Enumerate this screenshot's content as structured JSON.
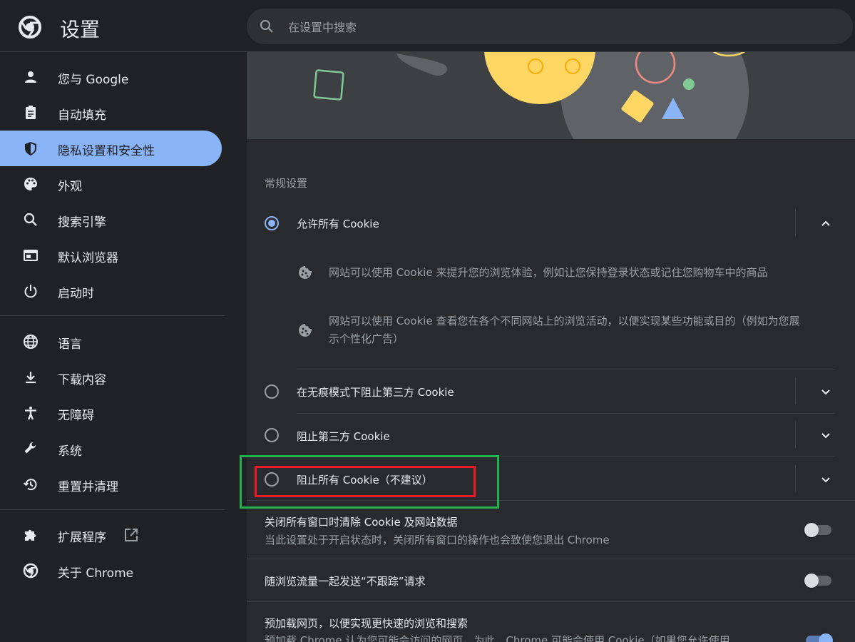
{
  "header": {
    "title": "设置",
    "search_placeholder": "在设置中搜索"
  },
  "sidebar": {
    "items": [
      {
        "label": "您与 Google",
        "icon": "person-icon"
      },
      {
        "label": "自动填充",
        "icon": "clipboard-icon"
      },
      {
        "label": "隐私设置和安全性",
        "icon": "shield-icon",
        "active": true
      },
      {
        "label": "外观",
        "icon": "palette-icon"
      },
      {
        "label": "搜索引擎",
        "icon": "search-icon"
      },
      {
        "label": "默认浏览器",
        "icon": "browser-icon"
      },
      {
        "label": "启动时",
        "icon": "power-icon"
      },
      {
        "label": "语言",
        "icon": "globe-icon"
      },
      {
        "label": "下载内容",
        "icon": "download-icon"
      },
      {
        "label": "无障碍",
        "icon": "accessibility-icon"
      },
      {
        "label": "系统",
        "icon": "wrench-icon"
      },
      {
        "label": "重置并清理",
        "icon": "history-icon"
      },
      {
        "label": "扩展程序",
        "icon": "puzzle-icon"
      },
      {
        "label": "关于 Chrome",
        "icon": "chrome-icon"
      }
    ]
  },
  "main": {
    "section_title": "常规设置",
    "options": [
      {
        "label": "允许所有 Cookie",
        "selected": true,
        "expanded": true
      },
      {
        "label": "在无痕模式下阻止第三方 Cookie",
        "selected": false
      },
      {
        "label": "阻止第三方 Cookie",
        "selected": false
      },
      {
        "label": "阻止所有 Cookie（不建议）",
        "selected": false
      }
    ],
    "details": [
      {
        "text": "网站可以使用 Cookie 来提升您的浏览体验，例如让您保持登录状态或记住您购物车中的商品"
      },
      {
        "line1": "网站可以使用 Cookie 查看您在各个不同网站上的浏览活动，以便实现某些功能或目的（例如为您展",
        "line2": "示个性化广告）"
      }
    ],
    "toggles": [
      {
        "label": "关闭所有窗口时清除 Cookie 及网站数据",
        "sub": "当此设置处于开启状态时，关闭所有窗口的操作也会致使您退出 Chrome",
        "on": false
      },
      {
        "label": "随浏览流量一起发送“不跟踪”请求",
        "on": false
      },
      {
        "label": "预加载网页，以便实现更快速的浏览和搜索",
        "sub": "预加载 Chrome 认为您可能会访问的网页。为此，Chrome 可能会使用 Cookie（如果您允许使用",
        "on": true
      }
    ]
  },
  "colors": {
    "accent": "#8ab4f8",
    "background": "#202124",
    "panel": "#292a2d",
    "annotation_green": "#22b14c",
    "annotation_red": "#ed1c24"
  }
}
